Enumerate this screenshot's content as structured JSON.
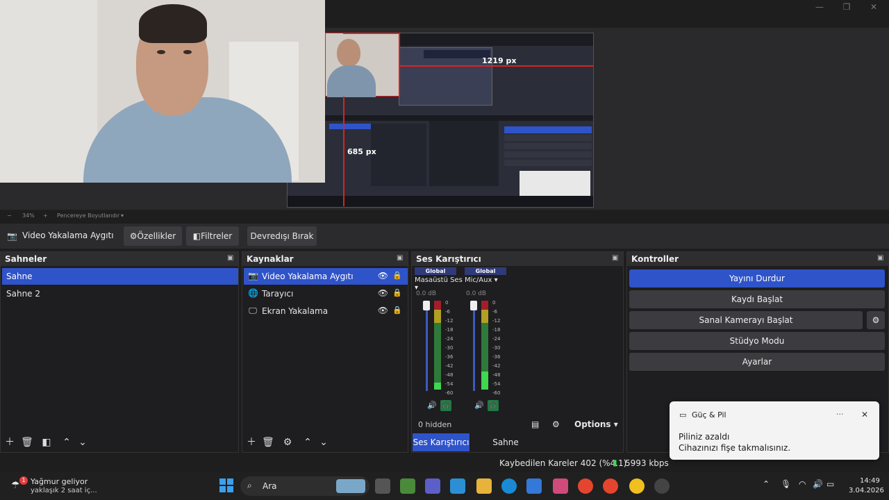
{
  "window": {
    "minimize_glyph": "—",
    "maximize_glyph": "❐",
    "close_glyph": "✕"
  },
  "preview": {
    "measure_width_label": "1219 px",
    "measure_height_label": "685 px"
  },
  "zoom": {
    "minus": "−",
    "value": "34%",
    "plus": "+",
    "mode": "Pencereye Boyutlandır",
    "caret": "▾"
  },
  "source_toolbar": {
    "current_source": "Video Yakalama Aygıtı",
    "properties": "Özellikler",
    "filters": "Filtreler",
    "deactivate": "Devredışı Bırak"
  },
  "scenes": {
    "title": "Sahneler",
    "items": [
      {
        "label": "Sahne",
        "selected": true
      },
      {
        "label": "Sahne 2",
        "selected": false
      }
    ]
  },
  "sources": {
    "title": "Kaynaklar",
    "items": [
      {
        "label": "Video Yakalama Aygıtı",
        "icon": "camera-icon",
        "glyph": "📷",
        "selected": true
      },
      {
        "label": "Tarayıcı",
        "icon": "globe-icon",
        "glyph": "🌐",
        "selected": false
      },
      {
        "label": "Ekran Yakalama",
        "icon": "monitor-icon",
        "glyph": "🖵",
        "selected": false
      }
    ]
  },
  "mixer": {
    "title": "Ses Karıştırıcı",
    "channels": [
      {
        "badge": "Global",
        "name": "Masaüstü Ses",
        "db": "0.0 dB",
        "level": 0.08
      },
      {
        "badge": "Global",
        "name": "Mic/Aux",
        "db": "0.0 dB",
        "level": 0.2
      }
    ],
    "scale": [
      "0",
      "-6",
      "-12",
      "-18",
      "-24",
      "-30",
      "-36",
      "-42",
      "-48",
      "-54",
      "-60"
    ],
    "hidden": "0 hidden",
    "options": "Options",
    "tab_mixer": "Ses Karıştırıcı",
    "tab_transitions": "Sahne Geçişleri"
  },
  "controls": {
    "title": "Kontroller",
    "stop_stream": "Yayını Durdur",
    "start_recording": "Kaydı Başlat",
    "start_virtual_cam": "Sanal Kamerayı Başlat",
    "studio_mode": "Stüdyo Modu",
    "settings": "Ayarlar"
  },
  "status": {
    "dropped_frames": "Kaybedilen Kareler 402 (%4.1)",
    "bitrate": "5993 kbps",
    "accent": "#3fd84f"
  },
  "toast": {
    "app": "Güç & Pil",
    "title": "Piliniz azaldı",
    "body": "Cihazınızı fişe takmalısınız.",
    "more": "···",
    "close": "✕"
  },
  "taskbar": {
    "weather_title": "Yağmur geliyor",
    "weather_sub": "yaklaşık 2 saat iç...",
    "weather_badge": "1",
    "search": "Ara",
    "time": "14:49",
    "date": "3.04.2026"
  },
  "colors": {
    "accent_blue": "#2f53c9",
    "panel": "#1e1d1f",
    "button": "#3c3c40"
  }
}
